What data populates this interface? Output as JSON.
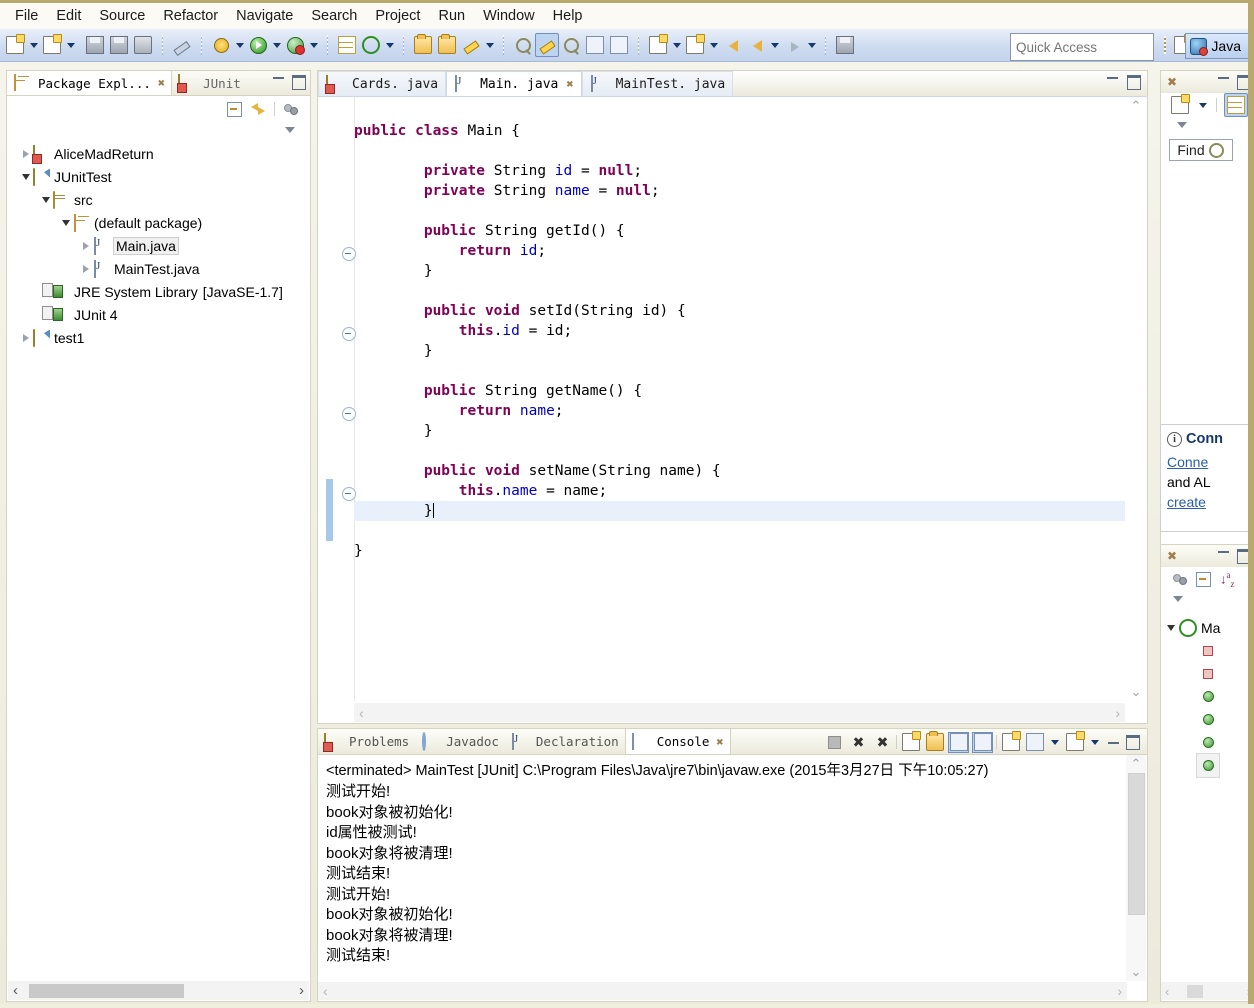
{
  "menu": {
    "items": [
      "File",
      "Edit",
      "Source",
      "Refactor",
      "Navigate",
      "Search",
      "Project",
      "Run",
      "Window",
      "Help"
    ]
  },
  "toolbar": {
    "icons": [
      "new-wizard-icon",
      "new-wizard-dropdown",
      "new-java-class-icon",
      "new-java-class-dropdown",
      "save-icon",
      "save-all-icon",
      "print-icon",
      "toggle-mark-occurrences-icon",
      "debug-icon",
      "debug-dropdown",
      "run-icon",
      "run-dropdown",
      "run-junit-icon",
      "run-junit-dropdown",
      "new-package-icon",
      "refresh-icon",
      "refresh-dropdown",
      "open-type-icon",
      "open-task-icon",
      "search-icon",
      "search-dropdown",
      "next-annotation-icon",
      "previous-annotation-icon",
      "last-edit-location-icon",
      "toggle-block-selection-icon",
      "show-whitespace-icon",
      "forward-history-icon",
      "forward-dropdown",
      "back-history-icon",
      "back-dropdown",
      "previous-edit-icon",
      "next-edit-icon",
      "next-dropdown",
      "pin-editor-icon"
    ]
  },
  "quick_access": {
    "placeholder": "Quick Access",
    "value": ""
  },
  "perspective": {
    "open_perspective_label": "",
    "current": "Java"
  },
  "package_explorer": {
    "tabs": [
      {
        "label": "Package Expl...",
        "active": true,
        "icon": "package-explorer-icon",
        "close": "✖"
      },
      {
        "label": "JUnit",
        "active": false,
        "icon": "junit-icon"
      }
    ],
    "toolbar": [
      "collapse-all-icon",
      "link-with-editor-icon",
      "view-filter-icon",
      "view-menu-icon"
    ],
    "tree": [
      {
        "label": "AliceMadReturn",
        "indent": 0,
        "twisty": "closed",
        "icon": "java-project-error-icon",
        "selected": false
      },
      {
        "label": "JUnitTest",
        "indent": 0,
        "twisty": "open",
        "icon": "java-project-icon",
        "selected": false
      },
      {
        "label": "src",
        "indent": 1,
        "twisty": "open",
        "icon": "source-folder-icon",
        "selected": false
      },
      {
        "label": "(default package)",
        "indent": 2,
        "twisty": "open",
        "icon": "package-icon",
        "selected": false
      },
      {
        "label": "Main.java",
        "indent": 3,
        "twisty": "closed",
        "icon": "java-file-icon",
        "selected": true
      },
      {
        "label": "MainTest.java",
        "indent": 3,
        "twisty": "closed",
        "icon": "java-file-icon",
        "selected": false
      },
      {
        "label": "JRE System Library",
        "suffix": "[JavaSE-1.7]",
        "indent": 1,
        "twisty": "closed",
        "icon": "library-icon",
        "selected": false
      },
      {
        "label": "JUnit 4",
        "indent": 1,
        "twisty": "closed",
        "icon": "library-icon",
        "selected": false
      },
      {
        "label": "test1",
        "indent": 0,
        "twisty": "closed",
        "icon": "java-project-icon",
        "selected": false
      }
    ]
  },
  "editor": {
    "tabs": [
      {
        "label": "Cards. java",
        "active": false,
        "icon": "java-file-error-icon"
      },
      {
        "label": "Main. java",
        "active": true,
        "icon": "java-file-icon",
        "close": "✖"
      },
      {
        "label": "MainTest. java",
        "active": false,
        "icon": "java-file-icon"
      }
    ],
    "code_lines": [
      [
        {
          "t": "public ",
          "c": "kw"
        },
        {
          "t": "class ",
          "c": "kw"
        },
        {
          "t": "Main {",
          "c": ""
        }
      ],
      [],
      [
        {
          "t": "        ",
          "c": ""
        },
        {
          "t": "private ",
          "c": "kw"
        },
        {
          "t": "String ",
          "c": ""
        },
        {
          "t": "id",
          "c": "fld"
        },
        {
          "t": " = ",
          "c": ""
        },
        {
          "t": "null",
          "c": "kw"
        },
        {
          "t": ";",
          "c": ""
        }
      ],
      [
        {
          "t": "        ",
          "c": ""
        },
        {
          "t": "private ",
          "c": "kw"
        },
        {
          "t": "String ",
          "c": ""
        },
        {
          "t": "name",
          "c": "fld"
        },
        {
          "t": " = ",
          "c": ""
        },
        {
          "t": "null",
          "c": "kw"
        },
        {
          "t": ";",
          "c": ""
        }
      ],
      [],
      [
        {
          "t": "        ",
          "c": ""
        },
        {
          "t": "public ",
          "c": "kw"
        },
        {
          "t": "String getId() {",
          "c": ""
        }
      ],
      [
        {
          "t": "            ",
          "c": ""
        },
        {
          "t": "return ",
          "c": "kw"
        },
        {
          "t": "id",
          "c": "fld"
        },
        {
          "t": ";",
          "c": ""
        }
      ],
      [
        {
          "t": "        }",
          "c": ""
        }
      ],
      [],
      [
        {
          "t": "        ",
          "c": ""
        },
        {
          "t": "public void ",
          "c": "kw"
        },
        {
          "t": "setId(String id) {",
          "c": ""
        }
      ],
      [
        {
          "t": "            ",
          "c": ""
        },
        {
          "t": "this",
          "c": "kw"
        },
        {
          "t": ".",
          "c": ""
        },
        {
          "t": "id",
          "c": "fld"
        },
        {
          "t": " = id;",
          "c": ""
        }
      ],
      [
        {
          "t": "        }",
          "c": ""
        }
      ],
      [],
      [
        {
          "t": "        ",
          "c": ""
        },
        {
          "t": "public ",
          "c": "kw"
        },
        {
          "t": "String getName() {",
          "c": ""
        }
      ],
      [
        {
          "t": "            ",
          "c": ""
        },
        {
          "t": "return ",
          "c": "kw"
        },
        {
          "t": "name",
          "c": "fld"
        },
        {
          "t": ";",
          "c": ""
        }
      ],
      [
        {
          "t": "        }",
          "c": ""
        }
      ],
      [],
      [
        {
          "t": "        ",
          "c": ""
        },
        {
          "t": "public void ",
          "c": "kw"
        },
        {
          "t": "setName(String name) {",
          "c": ""
        }
      ],
      [
        {
          "t": "            ",
          "c": ""
        },
        {
          "t": "this",
          "c": "kw"
        },
        {
          "t": ".",
          "c": ""
        },
        {
          "t": "name",
          "c": "fld"
        },
        {
          "t": " = name;",
          "c": ""
        }
      ],
      [
        {
          "t": "        }",
          "c": "",
          "caret": true
        }
      ],
      [],
      [
        {
          "t": "}",
          "c": ""
        }
      ]
    ],
    "cursor_line_index": 19,
    "folding_markers": [
      5,
      9,
      13,
      17
    ],
    "change_bar_color": "#a8c8e8"
  },
  "console": {
    "tabs": [
      {
        "label": "Problems",
        "active": false,
        "icon": "problems-icon"
      },
      {
        "label": "Javadoc",
        "active": false,
        "icon": "javadoc-icon"
      },
      {
        "label": "Declaration",
        "active": false,
        "icon": "declaration-icon"
      },
      {
        "label": "Console",
        "active": true,
        "icon": "console-icon",
        "close": "✖"
      }
    ],
    "toolbar": [
      "terminate-icon",
      "remove-launch-icon",
      "remove-all-launches-icon",
      "clear-console-icon",
      "scroll-lock-icon",
      "show-console-on-output-icon",
      "show-console-on-error-icon",
      "pin-console-icon",
      "display-selected-console-icon",
      "display-selected-dropdown",
      "open-console-icon",
      "open-console-dropdown",
      "minimize-icon",
      "maximize-icon"
    ],
    "header": "<terminated> MainTest [JUnit] C:\\Program Files\\Java\\jre7\\bin\\javaw.exe (2015年3月27日 下午10:05:27)",
    "output": [
      "测试开始!",
      "book对象被初始化!",
      "id属性被测试!",
      "book对象将被清理!",
      "测试结束!",
      "测试开始!",
      "book对象被初始化!",
      "book对象将被清理!",
      "测试结束!"
    ]
  },
  "right_views": {
    "task_list": {
      "close": "✖",
      "toolbar": [
        "new-task-icon",
        "new-task-dropdown",
        "categorize-icon",
        "view-menu-icon"
      ],
      "find_label": "Find"
    },
    "mylyn_notice": {
      "title": "Conn",
      "line1": "Conne",
      "line2": "and AL",
      "line3": "create"
    },
    "outline": {
      "close": "✖",
      "toolbar": [
        "hide-fields-icon",
        "collapse-all-icon",
        "sort-icon",
        "view-menu-icon"
      ],
      "root": "Ma",
      "members": [
        {
          "kind": "field",
          "selected": false
        },
        {
          "kind": "field",
          "selected": false
        },
        {
          "kind": "method",
          "selected": false
        },
        {
          "kind": "method",
          "selected": false
        },
        {
          "kind": "method",
          "selected": false
        },
        {
          "kind": "method",
          "selected": true
        }
      ]
    }
  },
  "scrollbars": {
    "left_arrow": "‹",
    "right_arrow": "›",
    "up_arrow": "⌃",
    "down_arrow": "⌄"
  }
}
